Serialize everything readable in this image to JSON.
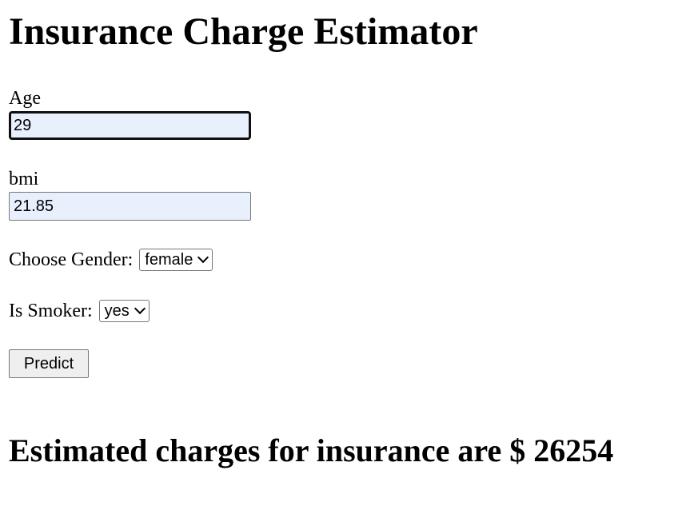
{
  "page": {
    "title": "Insurance Charge Estimator"
  },
  "form": {
    "age": {
      "label": "Age",
      "value": "29"
    },
    "bmi": {
      "label": "bmi",
      "value": "21.85"
    },
    "gender": {
      "label": "Choose Gender:",
      "selected": "female"
    },
    "smoker": {
      "label": "Is Smoker:",
      "selected": "yes"
    },
    "submit_label": "Predict"
  },
  "result": {
    "text": "Estimated charges for insurance are $ 26254"
  },
  "colors": {
    "input_autofill_bg": "#e8f0fe",
    "button_bg": "#efefef",
    "border": "#767676"
  },
  "icons": {
    "select_arrow": "chevron-down-icon"
  }
}
